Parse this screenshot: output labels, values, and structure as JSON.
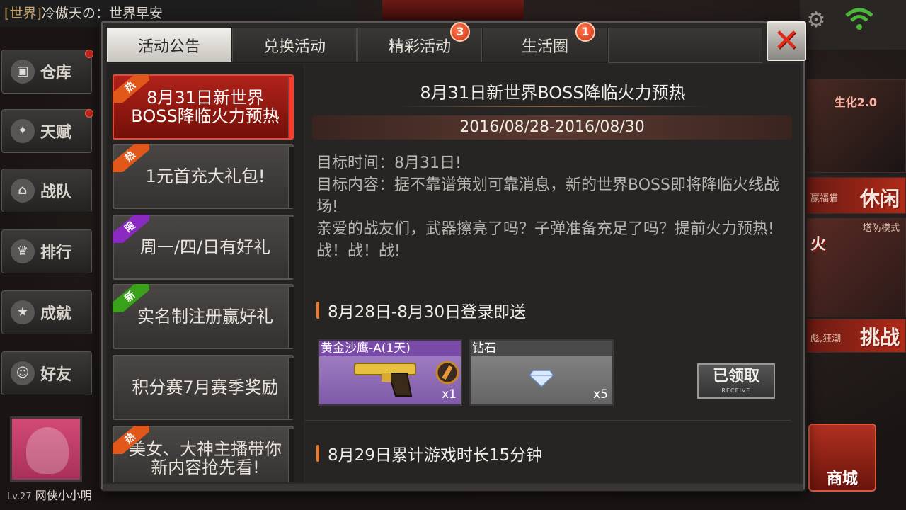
{
  "hud": {
    "world_chat_tag": "[世界]",
    "world_chat_text": "冷傲天の：世界早安",
    "player_level": "Lv.27",
    "player_name": "网侠小小明"
  },
  "left_menu": [
    {
      "label": "仓库",
      "icon": "warehouse-icon"
    },
    {
      "label": "天赋",
      "icon": "talent-icon"
    },
    {
      "label": "战队",
      "icon": "clan-icon"
    },
    {
      "label": "排行",
      "icon": "trophy-icon"
    },
    {
      "label": "成就",
      "icon": "achievement-icon"
    },
    {
      "label": "好友",
      "icon": "friends-icon"
    }
  ],
  "right_side": {
    "mode1": "生化2.0",
    "mode2_sub": "赢福猫",
    "mode2": "休闲",
    "mode3_sub": "塔防模式",
    "mode3": "火",
    "mode4_sub": "彪,狂潮",
    "mode4": "挑战",
    "shop_label": "商城"
  },
  "dialog": {
    "tabs": [
      {
        "label": "活动公告",
        "active": true,
        "badge": ""
      },
      {
        "label": "兑换活动",
        "active": false,
        "badge": ""
      },
      {
        "label": "精彩活动",
        "active": false,
        "badge": "3"
      },
      {
        "label": "生活圈",
        "active": false,
        "badge": "1"
      }
    ],
    "close_symbol": "✕",
    "list": [
      {
        "ribbon": "热",
        "ribbon_type": "hot",
        "label": "8月31日新世界BOSS降临火力预热",
        "active": true
      },
      {
        "ribbon": "热",
        "ribbon_type": "hot",
        "label": "1元首充大礼包!",
        "active": false
      },
      {
        "ribbon": "限",
        "ribbon_type": "lim",
        "label": "周一/四/日有好礼",
        "active": false
      },
      {
        "ribbon": "新",
        "ribbon_type": "new",
        "label": "实名制注册赢好礼",
        "active": false
      },
      {
        "ribbon": "",
        "ribbon_type": "",
        "label": "积分赛7月赛季奖励",
        "active": false
      },
      {
        "ribbon": "热",
        "ribbon_type": "hot",
        "label": "美女、大神主播带你新内容抢先看!",
        "active": false
      }
    ],
    "content": {
      "title": "8月31日新世界BOSS降临火力预热",
      "date_range": "2016/08/28-2016/08/30",
      "desc": [
        "目标时间：8月31日!",
        "目标内容：据不靠谱策划可靠消息，新的世界BOSS即将降临火线战场!",
        "亲爱的战友们，武器擦亮了吗？子弹准备充足了吗？提前火力预热!",
        "战！战！战!"
      ],
      "section1_title": "8月28日-8月30日登录即送",
      "rewards": [
        {
          "name": "黄金沙鹰-A(1天)",
          "qty": "x1",
          "icon": "golden-pistol-icon"
        },
        {
          "name": "钻石",
          "qty": "x5",
          "icon": "diamond-icon"
        }
      ],
      "received_label": "已领取",
      "received_en": "RECEIVE",
      "section2_title": "8月29日累计游戏时长15分钟"
    }
  }
}
